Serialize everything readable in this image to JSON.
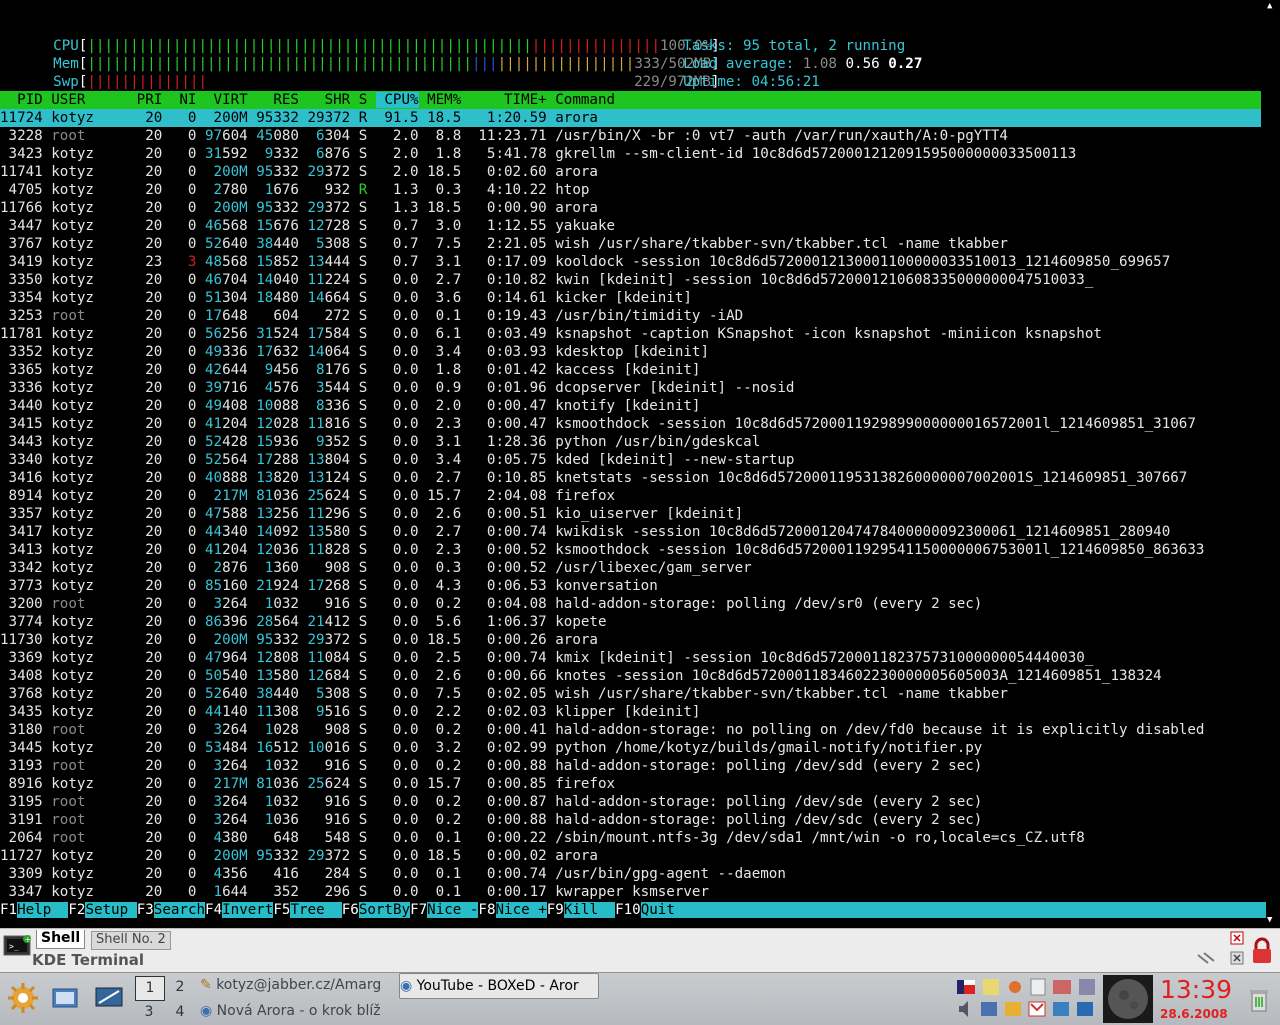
{
  "meters": {
    "cpu": {
      "label": "CPU",
      "value": "100.0%",
      "fraction": 1.0
    },
    "mem": {
      "label": "Mem",
      "value": "333/502MB",
      "fraction": 0.66
    },
    "swp": {
      "label": "Swp",
      "value": "229/972MB",
      "fraction": 0.24
    }
  },
  "stats": {
    "tasks_label": "Tasks:",
    "tasks_value": "95 total, 2 running",
    "load_label": "Load average:",
    "load1": "1.08",
    "load5": "0.56",
    "load15": "0.27",
    "uptime_label": "Uptime:",
    "uptime_value": "04:56:21"
  },
  "columns": [
    "PID",
    "USER",
    "PRI",
    "NI",
    "VIRT",
    "RES",
    "SHR",
    "S",
    "CPU%",
    "MEM%",
    "TIME+",
    "Command"
  ],
  "processes": [
    [
      "11724",
      "kotyz",
      "20",
      "0",
      "200M",
      "95332",
      "29372",
      "R",
      "91.5",
      "18.5",
      "1:20.59",
      "arora"
    ],
    [
      "3228",
      "root",
      "20",
      "0",
      "97604",
      "45080",
      "6304",
      "S",
      "2.0",
      "8.8",
      "11:23.71",
      "/usr/bin/X -br :0 vt7 -auth /var/run/xauth/A:0-pgYTT4"
    ],
    [
      "3423",
      "kotyz",
      "20",
      "0",
      "31592",
      "9332",
      "6876",
      "S",
      "2.0",
      "1.8",
      "5:41.78",
      "gkrellm --sm-client-id 10c8d6d5720001212091595000000033500113"
    ],
    [
      "11741",
      "kotyz",
      "20",
      "0",
      "200M",
      "95332",
      "29372",
      "S",
      "2.0",
      "18.5",
      "0:02.60",
      "arora"
    ],
    [
      "4705",
      "kotyz",
      "20",
      "0",
      "2780",
      "1676",
      "932",
      "R",
      "1.3",
      "0.3",
      "4:10.22",
      "htop"
    ],
    [
      "11766",
      "kotyz",
      "20",
      "0",
      "200M",
      "95332",
      "29372",
      "S",
      "1.3",
      "18.5",
      "0:00.90",
      "arora"
    ],
    [
      "3447",
      "kotyz",
      "20",
      "0",
      "46568",
      "15676",
      "12728",
      "S",
      "0.7",
      "3.0",
      "1:12.55",
      "yakuake"
    ],
    [
      "3767",
      "kotyz",
      "20",
      "0",
      "52640",
      "38440",
      "5308",
      "S",
      "0.7",
      "7.5",
      "2:21.05",
      "wish /usr/share/tkabber-svn/tkabber.tcl -name tkabber"
    ],
    [
      "3419",
      "kotyz",
      "23",
      "3",
      "48568",
      "15852",
      "13444",
      "S",
      "0.7",
      "3.1",
      "0:17.09",
      "kooldock -session 10c8d6d57200012130001100000033510013_1214609850_699657"
    ],
    [
      "3350",
      "kotyz",
      "20",
      "0",
      "46704",
      "14040",
      "11224",
      "S",
      "0.0",
      "2.7",
      "0:10.82",
      "kwin [kdeinit] -session 10c8d6d5720001210608335000000047510033_"
    ],
    [
      "3354",
      "kotyz",
      "20",
      "0",
      "51304",
      "18480",
      "14664",
      "S",
      "0.0",
      "3.6",
      "0:14.61",
      "kicker [kdeinit]"
    ],
    [
      "3253",
      "root",
      "20",
      "0",
      "17648",
      "604",
      "272",
      "S",
      "0.0",
      "0.1",
      "0:19.43",
      "/usr/bin/timidity -iAD"
    ],
    [
      "11781",
      "kotyz",
      "20",
      "0",
      "56256",
      "31524",
      "17584",
      "S",
      "0.0",
      "6.1",
      "0:03.49",
      "ksnapshot -caption KSnapshot -icon ksnapshot -miniicon ksnapshot"
    ],
    [
      "3352",
      "kotyz",
      "20",
      "0",
      "49336",
      "17632",
      "14064",
      "S",
      "0.0",
      "3.4",
      "0:03.93",
      "kdesktop [kdeinit]"
    ],
    [
      "3365",
      "kotyz",
      "20",
      "0",
      "42644",
      "9456",
      "8176",
      "S",
      "0.0",
      "1.8",
      "0:01.42",
      "kaccess [kdeinit]"
    ],
    [
      "3336",
      "kotyz",
      "20",
      "0",
      "39716",
      "4576",
      "3544",
      "S",
      "0.0",
      "0.9",
      "0:01.96",
      "dcopserver [kdeinit] --nosid"
    ],
    [
      "3440",
      "kotyz",
      "20",
      "0",
      "49408",
      "10088",
      "8336",
      "S",
      "0.0",
      "2.0",
      "0:00.47",
      "knotify [kdeinit]"
    ],
    [
      "3415",
      "kotyz",
      "20",
      "0",
      "41204",
      "12028",
      "11816",
      "S",
      "0.0",
      "2.3",
      "0:00.47",
      "ksmoothdock -session 10c8d6d57200011929899000000016572001l_1214609851_31067"
    ],
    [
      "3443",
      "kotyz",
      "20",
      "0",
      "52428",
      "15936",
      "9352",
      "S",
      "0.0",
      "3.1",
      "1:28.36",
      "python /usr/bin/gdeskcal"
    ],
    [
      "3340",
      "kotyz",
      "20",
      "0",
      "52564",
      "17288",
      "13804",
      "S",
      "0.0",
      "3.4",
      "0:05.75",
      "kded [kdeinit] --new-startup"
    ],
    [
      "3416",
      "kotyz",
      "20",
      "0",
      "40888",
      "13820",
      "13124",
      "S",
      "0.0",
      "2.7",
      "0:10.85",
      "knetstats -session 10c8d6d57200011953138260000007002001S_1214609851_307667"
    ],
    [
      "8914",
      "kotyz",
      "20",
      "0",
      "217M",
      "81036",
      "25624",
      "S",
      "0.0",
      "15.7",
      "2:04.08",
      "firefox"
    ],
    [
      "3357",
      "kotyz",
      "20",
      "0",
      "47588",
      "13256",
      "11296",
      "S",
      "0.0",
      "2.6",
      "0:00.51",
      "kio_uiserver [kdeinit]"
    ],
    [
      "3417",
      "kotyz",
      "20",
      "0",
      "44340",
      "14092",
      "13580",
      "S",
      "0.0",
      "2.7",
      "0:00.74",
      "kwikdisk -session 10c8d6d57200012047478400000092300061_1214609851_280940"
    ],
    [
      "3413",
      "kotyz",
      "20",
      "0",
      "41204",
      "12036",
      "11828",
      "S",
      "0.0",
      "2.3",
      "0:00.52",
      "ksmoothdock -session 10c8d6d57200011929541150000006753001l_1214609850_863633"
    ],
    [
      "3342",
      "kotyz",
      "20",
      "0",
      "2876",
      "1360",
      "908",
      "S",
      "0.0",
      "0.3",
      "0:00.52",
      "/usr/libexec/gam_server"
    ],
    [
      "3773",
      "kotyz",
      "20",
      "0",
      "85160",
      "21924",
      "17268",
      "S",
      "0.0",
      "4.3",
      "0:06.53",
      "konversation"
    ],
    [
      "3200",
      "root",
      "20",
      "0",
      "3264",
      "1032",
      "916",
      "S",
      "0.0",
      "0.2",
      "0:04.08",
      "hald-addon-storage: polling /dev/sr0 (every 2 sec)"
    ],
    [
      "3774",
      "kotyz",
      "20",
      "0",
      "86396",
      "28564",
      "21412",
      "S",
      "0.0",
      "5.6",
      "1:06.37",
      "kopete"
    ],
    [
      "11730",
      "kotyz",
      "20",
      "0",
      "200M",
      "95332",
      "29372",
      "S",
      "0.0",
      "18.5",
      "0:00.26",
      "arora"
    ],
    [
      "3369",
      "kotyz",
      "20",
      "0",
      "47964",
      "12808",
      "11084",
      "S",
      "0.0",
      "2.5",
      "0:00.74",
      "kmix [kdeinit] -session 10c8d6d5720001182375731000000054440030_"
    ],
    [
      "3408",
      "kotyz",
      "20",
      "0",
      "50540",
      "13580",
      "12684",
      "S",
      "0.0",
      "2.6",
      "0:00.66",
      "knotes -session 10c8d6d57200011834602230000005605003A_1214609851_138324"
    ],
    [
      "3768",
      "kotyz",
      "20",
      "0",
      "52640",
      "38440",
      "5308",
      "S",
      "0.0",
      "7.5",
      "0:02.05",
      "wish /usr/share/tkabber-svn/tkabber.tcl -name tkabber"
    ],
    [
      "3435",
      "kotyz",
      "20",
      "0",
      "44140",
      "11308",
      "9516",
      "S",
      "0.0",
      "2.2",
      "0:02.03",
      "klipper [kdeinit]"
    ],
    [
      "3180",
      "root",
      "20",
      "0",
      "3264",
      "1028",
      "908",
      "S",
      "0.0",
      "0.2",
      "0:00.41",
      "hald-addon-storage: no polling on /dev/fd0 because it is explicitly disabled"
    ],
    [
      "3445",
      "kotyz",
      "20",
      "0",
      "53484",
      "16512",
      "10016",
      "S",
      "0.0",
      "3.2",
      "0:02.99",
      "python /home/kotyz/builds/gmail-notify/notifier.py"
    ],
    [
      "3193",
      "root",
      "20",
      "0",
      "3264",
      "1032",
      "916",
      "S",
      "0.0",
      "0.2",
      "0:00.88",
      "hald-addon-storage: polling /dev/sdd (every 2 sec)"
    ],
    [
      "8916",
      "kotyz",
      "20",
      "0",
      "217M",
      "81036",
      "25624",
      "S",
      "0.0",
      "15.7",
      "0:00.85",
      "firefox"
    ],
    [
      "3195",
      "root",
      "20",
      "0",
      "3264",
      "1032",
      "916",
      "S",
      "0.0",
      "0.2",
      "0:00.87",
      "hald-addon-storage: polling /dev/sde (every 2 sec)"
    ],
    [
      "3191",
      "root",
      "20",
      "0",
      "3264",
      "1036",
      "916",
      "S",
      "0.0",
      "0.2",
      "0:00.88",
      "hald-addon-storage: polling /dev/sdc (every 2 sec)"
    ],
    [
      "2064",
      "root",
      "20",
      "0",
      "4380",
      "648",
      "548",
      "S",
      "0.0",
      "0.1",
      "0:00.22",
      "/sbin/mount.ntfs-3g /dev/sda1 /mnt/win -o ro,locale=cs_CZ.utf8"
    ],
    [
      "11727",
      "kotyz",
      "20",
      "0",
      "200M",
      "95332",
      "29372",
      "S",
      "0.0",
      "18.5",
      "0:00.02",
      "arora"
    ],
    [
      "3309",
      "kotyz",
      "20",
      "0",
      "4356",
      "416",
      "284",
      "S",
      "0.0",
      "0.1",
      "0:00.74",
      "/usr/bin/gpg-agent --daemon"
    ],
    [
      "3347",
      "kotyz",
      "20",
      "0",
      "1644",
      "352",
      "296",
      "S",
      "0.0",
      "0.1",
      "0:00.17",
      "kwrapper ksmserver"
    ]
  ],
  "fkeys": [
    {
      "key": "F1",
      "label": "Help  "
    },
    {
      "key": "F2",
      "label": "Setup "
    },
    {
      "key": "F3",
      "label": "Search"
    },
    {
      "key": "F4",
      "label": "Invert"
    },
    {
      "key": "F5",
      "label": "Tree  "
    },
    {
      "key": "F6",
      "label": "SortBy"
    },
    {
      "key": "F7",
      "label": "Nice -"
    },
    {
      "key": "F8",
      "label": "Nice +"
    },
    {
      "key": "F9",
      "label": "Kill  "
    },
    {
      "key": "F10",
      "label": "Quit"
    }
  ],
  "konsole": {
    "tab_active": "Shell",
    "tab_other": "Shell No. 2",
    "window_title": "KDE Terminal"
  },
  "taskbar": {
    "desktops": [
      "1",
      "2",
      "3",
      "4"
    ],
    "tasks": [
      "kotyz@jabber.cz/Amarg",
      "YouTube - BOXeD - Aror",
      "Nová Arora - o krok blíž"
    ],
    "clock": "13:39",
    "date": "28.6.2008"
  },
  "colors": {
    "header_bg": "#1fc51f",
    "selected_bg": "#2fbfcb",
    "cyan": "#37c6d6"
  }
}
